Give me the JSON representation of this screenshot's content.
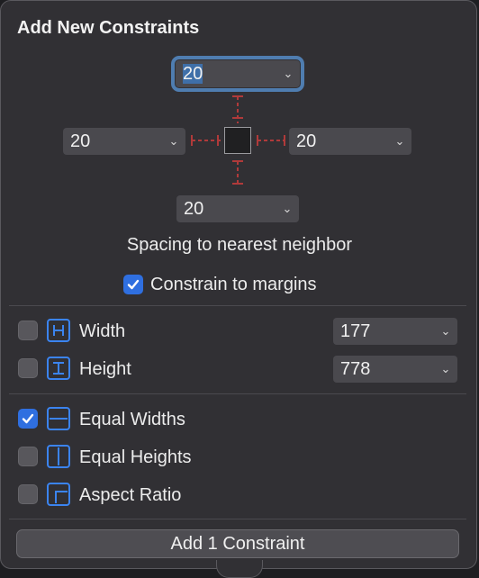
{
  "title": "Add New Constraints",
  "spacing": {
    "top": "20",
    "left": "20",
    "right": "20",
    "bottom": "20",
    "caption": "Spacing to nearest neighbor"
  },
  "constrain_margins": {
    "label": "Constrain to margins",
    "checked": true
  },
  "size": {
    "width": {
      "label": "Width",
      "value": "177",
      "checked": false
    },
    "height": {
      "label": "Height",
      "value": "778",
      "checked": false
    }
  },
  "equal": {
    "widths": {
      "label": "Equal Widths",
      "checked": true
    },
    "heights": {
      "label": "Equal Heights",
      "checked": false
    },
    "aspect": {
      "label": "Aspect Ratio",
      "checked": false
    }
  },
  "button_label": "Add 1 Constraint",
  "colors": {
    "accent": "#3b84f0",
    "checkbox_on": "#2f6fe0",
    "strut": "#b03a3a"
  },
  "icons": [
    "chevron-down-icon",
    "checkmark-icon",
    "width-icon",
    "height-icon",
    "equal-widths-icon",
    "equal-heights-icon",
    "aspect-ratio-icon"
  ]
}
